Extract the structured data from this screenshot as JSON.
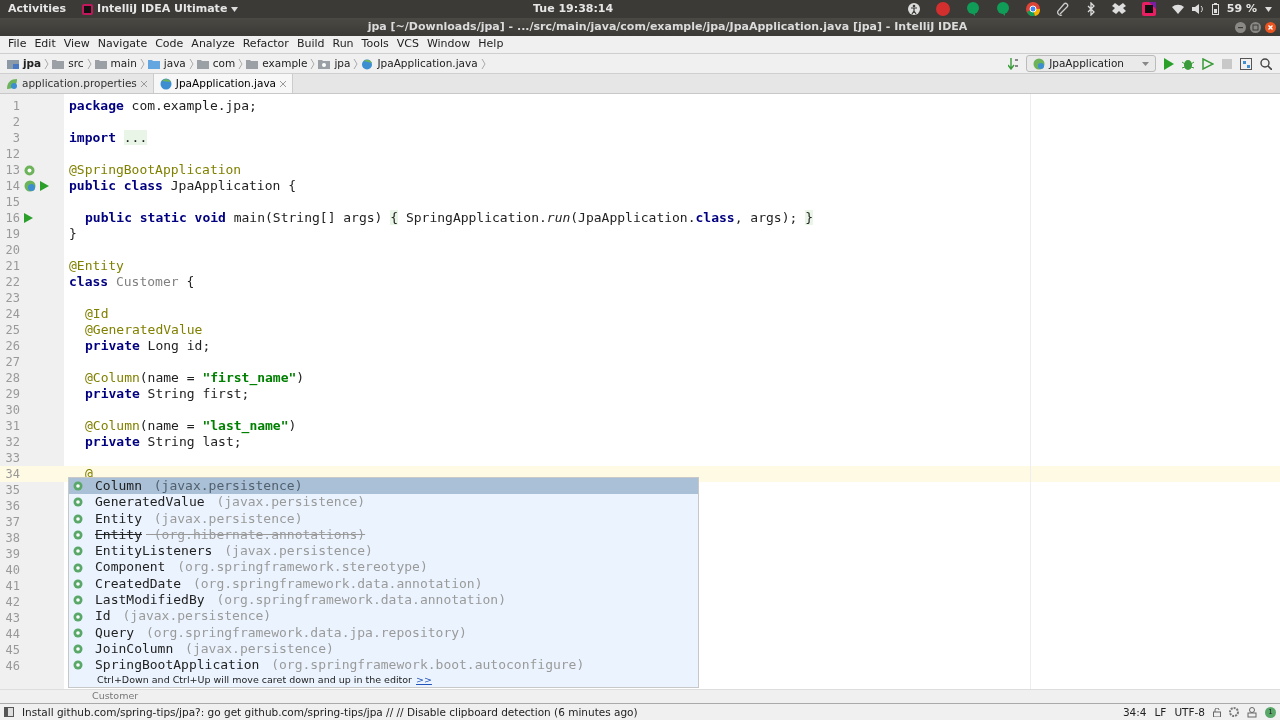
{
  "top_bar": {
    "activities": "Activities",
    "app_menu": "IntelliJ IDEA Ultimate",
    "clock": "Tue 19:38:14",
    "battery": "59 %"
  },
  "window": {
    "title": "jpa [~/Downloads/jpa] - .../src/main/java/com/example/jpa/JpaApplication.java [jpa] - IntelliJ IDEA"
  },
  "menu": [
    "File",
    "Edit",
    "View",
    "Navigate",
    "Code",
    "Analyze",
    "Refactor",
    "Build",
    "Run",
    "Tools",
    "VCS",
    "Window",
    "Help"
  ],
  "nav_bar": {
    "crumbs": [
      {
        "label": "jpa",
        "kind": "module"
      },
      {
        "label": "src",
        "kind": "folder"
      },
      {
        "label": "main",
        "kind": "folder"
      },
      {
        "label": "java",
        "kind": "source"
      },
      {
        "label": "com",
        "kind": "folder"
      },
      {
        "label": "example",
        "kind": "folder"
      },
      {
        "label": "jpa",
        "kind": "package"
      },
      {
        "label": "JpaApplication.java",
        "kind": "class"
      }
    ],
    "run_config": "JpaApplication"
  },
  "tabs": [
    {
      "label": "application.properties",
      "selected": false,
      "kind": "properties"
    },
    {
      "label": "JpaApplication.java",
      "selected": true,
      "kind": "class"
    }
  ],
  "editor": {
    "lines": [
      {
        "number": "1",
        "current": false,
        "tokens": [
          {
            "kind": "kw",
            "text": "package"
          },
          {
            "kind": "plain",
            "text": " com.example.jpa;"
          }
        ]
      },
      {
        "number": "2",
        "current": false
      },
      {
        "number": "3",
        "current": false,
        "tokens": [
          {
            "kind": "kw",
            "text": "import "
          },
          {
            "kind": "folded",
            "text": "..."
          }
        ]
      },
      {
        "number": "12",
        "current": false
      },
      {
        "number": "13",
        "current": false,
        "gutter": [
          {
            "kind": "bean"
          }
        ],
        "tokens": [
          {
            "kind": "ann",
            "text": "@SpringBootApplication"
          }
        ]
      },
      {
        "number": "14",
        "current": false,
        "gutter": [
          {
            "kind": "class"
          },
          {
            "kind": "run"
          }
        ],
        "tokens": [
          {
            "kind": "kw",
            "text": "public class"
          },
          {
            "kind": "plain",
            "text": " JpaApplication {"
          }
        ]
      },
      {
        "number": "15",
        "current": false
      },
      {
        "number": "16",
        "current": false,
        "indented": true,
        "gutter": [
          {
            "kind": "run"
          }
        ],
        "tokens": [
          {
            "kind": "kw",
            "text": "public static void"
          },
          {
            "kind": "plain",
            "text": " main(String[] args) "
          },
          {
            "kind": "folded",
            "text": "{"
          },
          {
            "kind": "plain",
            "text": " SpringApplication."
          },
          {
            "kind": "ital",
            "text": "run"
          },
          {
            "kind": "plain",
            "text": "(JpaApplication."
          },
          {
            "kind": "kw",
            "text": "class"
          },
          {
            "kind": "plain",
            "text": ", args); "
          },
          {
            "kind": "folded",
            "text": "}"
          }
        ]
      },
      {
        "number": "19",
        "current": false,
        "tokens": [
          {
            "kind": "plain",
            "text": "}"
          }
        ]
      },
      {
        "number": "20",
        "current": false
      },
      {
        "number": "21",
        "current": false,
        "tokens": [
          {
            "kind": "ann",
            "text": "@Entity"
          }
        ]
      },
      {
        "number": "22",
        "current": false,
        "tokens": [
          {
            "kind": "kw",
            "text": "class "
          },
          {
            "kind": "unused",
            "text": "Customer"
          },
          {
            "kind": "plain",
            "text": " {"
          }
        ]
      },
      {
        "number": "23",
        "current": false
      },
      {
        "number": "24",
        "current": false,
        "indented": true,
        "tokens": [
          {
            "kind": "ann",
            "text": "@Id"
          }
        ]
      },
      {
        "number": "25",
        "current": false,
        "indented": true,
        "tokens": [
          {
            "kind": "ann",
            "text": "@GeneratedValue"
          }
        ]
      },
      {
        "number": "26",
        "current": false,
        "indented": true,
        "tokens": [
          {
            "kind": "kw",
            "text": "private"
          },
          {
            "kind": "plain",
            "text": " Long id;"
          }
        ]
      },
      {
        "number": "27",
        "current": false
      },
      {
        "number": "28",
        "current": false,
        "indented": true,
        "tokens": [
          {
            "kind": "ann",
            "text": "@Column"
          },
          {
            "kind": "plain",
            "text": "(name = "
          },
          {
            "kind": "str",
            "text": "\"first_name\""
          },
          {
            "kind": "plain",
            "text": ")"
          }
        ]
      },
      {
        "number": "29",
        "current": false,
        "indented": true,
        "tokens": [
          {
            "kind": "kw",
            "text": "private"
          },
          {
            "kind": "plain",
            "text": " String first;"
          }
        ]
      },
      {
        "number": "30",
        "current": false
      },
      {
        "number": "31",
        "current": false,
        "indented": true,
        "tokens": [
          {
            "kind": "ann",
            "text": "@Column"
          },
          {
            "kind": "plain",
            "text": "(name = "
          },
          {
            "kind": "str",
            "text": "\"last_name\""
          },
          {
            "kind": "plain",
            "text": ")"
          }
        ]
      },
      {
        "number": "32",
        "current": false,
        "indented": true,
        "tokens": [
          {
            "kind": "kw",
            "text": "private"
          },
          {
            "kind": "plain",
            "text": " String last;"
          }
        ]
      },
      {
        "number": "33",
        "current": false
      },
      {
        "number": "34",
        "current": true,
        "indented": true,
        "tokens": [
          {
            "kind": "ann",
            "text": "@"
          }
        ]
      },
      {
        "number": "35",
        "current": false
      },
      {
        "number": "36",
        "current": false
      },
      {
        "number": "37",
        "current": false
      },
      {
        "number": "38",
        "current": false
      },
      {
        "number": "39",
        "current": false
      },
      {
        "number": "40",
        "current": false
      },
      {
        "number": "41",
        "current": false
      },
      {
        "number": "42",
        "current": false
      },
      {
        "number": "43",
        "current": false
      },
      {
        "number": "44",
        "current": false
      },
      {
        "number": "45",
        "current": false
      },
      {
        "number": "46",
        "current": false
      }
    ]
  },
  "completion": {
    "items": [
      {
        "name": "Column",
        "package": "(javax.persistence)",
        "selected": true,
        "deprecated": false
      },
      {
        "name": "GeneratedValue",
        "package": "(javax.persistence)",
        "selected": false,
        "deprecated": false
      },
      {
        "name": "Entity",
        "package": "(javax.persistence)",
        "selected": false,
        "deprecated": false
      },
      {
        "name": "Entity",
        "package": "(org.hibernate.annotations)",
        "selected": false,
        "deprecated": true
      },
      {
        "name": "EntityListeners",
        "package": "(javax.persistence)",
        "selected": false,
        "deprecated": false
      },
      {
        "name": "Component",
        "package": "(org.springframework.stereotype)",
        "selected": false,
        "deprecated": false
      },
      {
        "name": "CreatedDate",
        "package": "(org.springframework.data.annotation)",
        "selected": false,
        "deprecated": false
      },
      {
        "name": "LastModifiedBy",
        "package": "(org.springframework.data.annotation)",
        "selected": false,
        "deprecated": false
      },
      {
        "name": "Id",
        "package": "(javax.persistence)",
        "selected": false,
        "deprecated": false
      },
      {
        "name": "Query",
        "package": "(org.springframework.data.jpa.repository)",
        "selected": false,
        "deprecated": false
      },
      {
        "name": "JoinColumn",
        "package": "(javax.persistence)",
        "selected": false,
        "deprecated": false
      },
      {
        "name": "SpringBootApplication",
        "package": "(org.springframework.boot.autoconfigure)",
        "selected": false,
        "deprecated": false
      }
    ],
    "hint": "Ctrl+Down and Ctrl+Up will move caret down and up in the editor",
    "hint_link": ">>"
  },
  "breadcrumb": "Customer",
  "status_bar": {
    "message": "Install github.com/spring-tips/jpa?: go get github.com/spring-tips/jpa // // Disable clipboard detection (6 minutes ago)",
    "position": "34:4",
    "line_separator": "LF",
    "encoding": "UTF-8",
    "notifications": "1"
  }
}
